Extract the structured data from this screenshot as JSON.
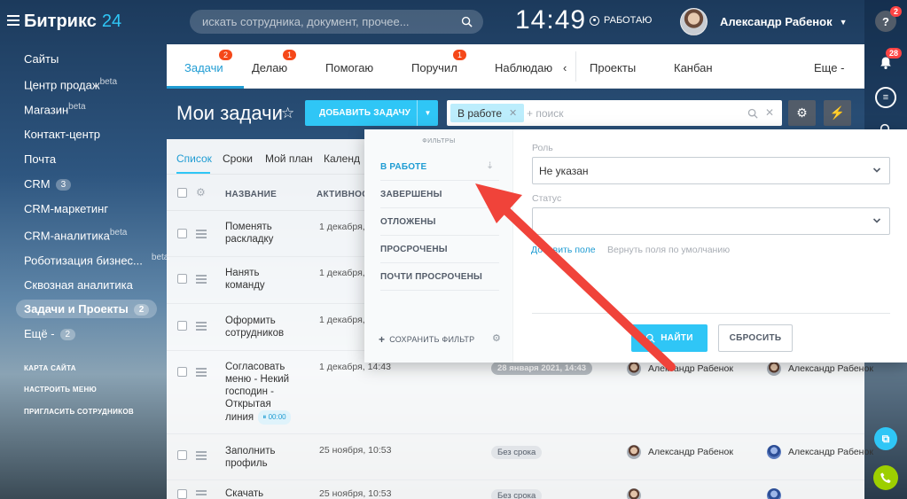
{
  "app": {
    "logo": "Битрикс",
    "logo_num": "24"
  },
  "header": {
    "search_placeholder": "искать сотрудника, документ, прочее...",
    "clock": "14:49",
    "work_status": "РАБОТАЮ",
    "user_name": "Александр Рабенок"
  },
  "rail": {
    "help_badge": "2",
    "notify_badge": "28"
  },
  "sidebar": {
    "items": [
      {
        "label": "Сайты"
      },
      {
        "label": "Центр продаж",
        "sup": "beta"
      },
      {
        "label": "Магазин",
        "sup": "beta"
      },
      {
        "label": "Контакт-центр"
      },
      {
        "label": "Почта"
      },
      {
        "label": "CRM",
        "count": "3"
      },
      {
        "label": "CRM-маркетинг"
      },
      {
        "label": "CRM-аналитика",
        "sup": "beta"
      },
      {
        "label": "Роботизация бизнес...",
        "sup": "beta"
      },
      {
        "label": "Сквозная аналитика"
      },
      {
        "label": "Задачи и Проекты",
        "count": "2"
      },
      {
        "label": "Ещё -",
        "count": "2"
      }
    ],
    "links": [
      "КАРТА САЙТА",
      "НАСТРОИТЬ МЕНЮ",
      "ПРИГЛАСИТЬ СОТРУДНИКОВ"
    ]
  },
  "tabs": [
    {
      "label": "Задачи",
      "badge": "2"
    },
    {
      "label": "Делаю",
      "badge": "1"
    },
    {
      "label": "Помогаю"
    },
    {
      "label": "Поручил",
      "badge": "1"
    },
    {
      "label": "Наблюдаю"
    },
    {
      "label": "‹"
    },
    {
      "label": "Проекты"
    },
    {
      "label": "Канбан"
    },
    {
      "label": "Еще -"
    }
  ],
  "toolbar": {
    "title": "Мои задачи",
    "add_task": "ДОБАВИТЬ ЗАДАЧУ",
    "filter_chip": "В работе",
    "filter_placeholder": "+ поиск"
  },
  "view_tabs": [
    "Список",
    "Сроки",
    "Мой план",
    "Календ"
  ],
  "table": {
    "headers": [
      "НАЗВАНИЕ",
      "АКТИВНОСТ"
    ],
    "rows": [
      {
        "name": "Поменять раскладку",
        "activity": "1 декабря,"
      },
      {
        "name": "Нанять команду",
        "activity": "1 декабря,"
      },
      {
        "name": "Оформить сотрудников",
        "activity": "1 декабря,"
      },
      {
        "name": "Согласовать меню - Некий господин - Открытая линия",
        "timer": "00:00",
        "activity": "1 декабря, 14:43",
        "deadline": "28 января 2021, 14:43",
        "responsible": "Александр Рабенок",
        "creator": "Александр Рабенок"
      },
      {
        "name": "Заполнить профиль",
        "activity": "25 ноября, 10:53",
        "deadline": "Без срока",
        "responsible": "Александр Рабенок",
        "creator": "Александр Рабенок"
      },
      {
        "name": "Скачать",
        "activity": "25 ноября, 10:53",
        "deadline": "Без срока"
      }
    ]
  },
  "filter_popup": {
    "title": "ФИЛЬТРЫ",
    "presets": [
      "В РАБОТЕ",
      "ЗАВЕРШЕНЫ",
      "ОТЛОЖЕНЫ",
      "ПРОСРОЧЕНЫ",
      "ПОЧТИ ПРОСРОЧЕНЫ"
    ],
    "save_filter": "СОХРАНИТЬ ФИЛЬТР",
    "role_label": "Роль",
    "role_value": "Не указан",
    "status_label": "Статус",
    "status_value": "",
    "add_field": "Добавить поле",
    "restore_fields": "Вернуть поля по умолчанию",
    "find": "НАЙТИ",
    "reset": "СБРОСИТЬ"
  },
  "colors": {
    "accent": "#2fc6f6",
    "link": "#1f9cd3",
    "badge": "#f54819",
    "arrow": "#f0433a"
  }
}
